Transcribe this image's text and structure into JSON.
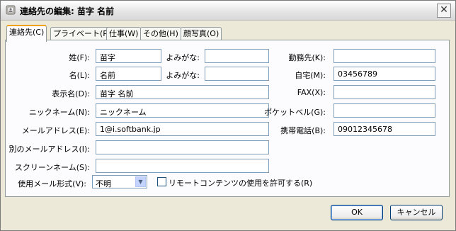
{
  "window": {
    "title": "連絡先の編集: 苗字 名前",
    "close_label": "✕"
  },
  "tabs": [
    {
      "label": "連絡先(C)"
    },
    {
      "label": "プライベート(P)"
    },
    {
      "label": "仕事(W)"
    },
    {
      "label": "その他(H)"
    },
    {
      "label": "顔写真(O)"
    }
  ],
  "form": {
    "last_name": {
      "label": "姓(F):",
      "value": "苗字"
    },
    "last_name_reading": {
      "label": "よみがな:",
      "value": ""
    },
    "first_name": {
      "label": "名(L):",
      "value": "名前"
    },
    "first_name_reading": {
      "label": "よみがな:",
      "value": ""
    },
    "display_name": {
      "label": "表示名(D):",
      "value": "苗字 名前"
    },
    "nickname": {
      "label": "ニックネーム(N):",
      "value": "ニックネーム"
    },
    "email": {
      "label": "メールアドレス(E):",
      "value": "1@i.softbank.jp"
    },
    "alt_email": {
      "label": "別のメールアドレス(I):",
      "value": ""
    },
    "screen_name": {
      "label": "スクリーンネーム(S):",
      "value": ""
    },
    "mail_format": {
      "label": "使用メール形式(V):",
      "value": "不明"
    },
    "remote_content": {
      "label": "リモートコンテンツの使用を許可する(R)"
    },
    "work_phone": {
      "label": "勤務先(K):",
      "value": ""
    },
    "home_phone": {
      "label": "自宅(M):",
      "value": "03456789"
    },
    "fax": {
      "label": "FAX(X):",
      "value": ""
    },
    "pager": {
      "label": "ポケットベル(G):",
      "value": ""
    },
    "mobile": {
      "label": "携帯電話(B):",
      "value": "09012345678"
    }
  },
  "buttons": {
    "ok": "OK",
    "cancel": "キャンセル"
  }
}
